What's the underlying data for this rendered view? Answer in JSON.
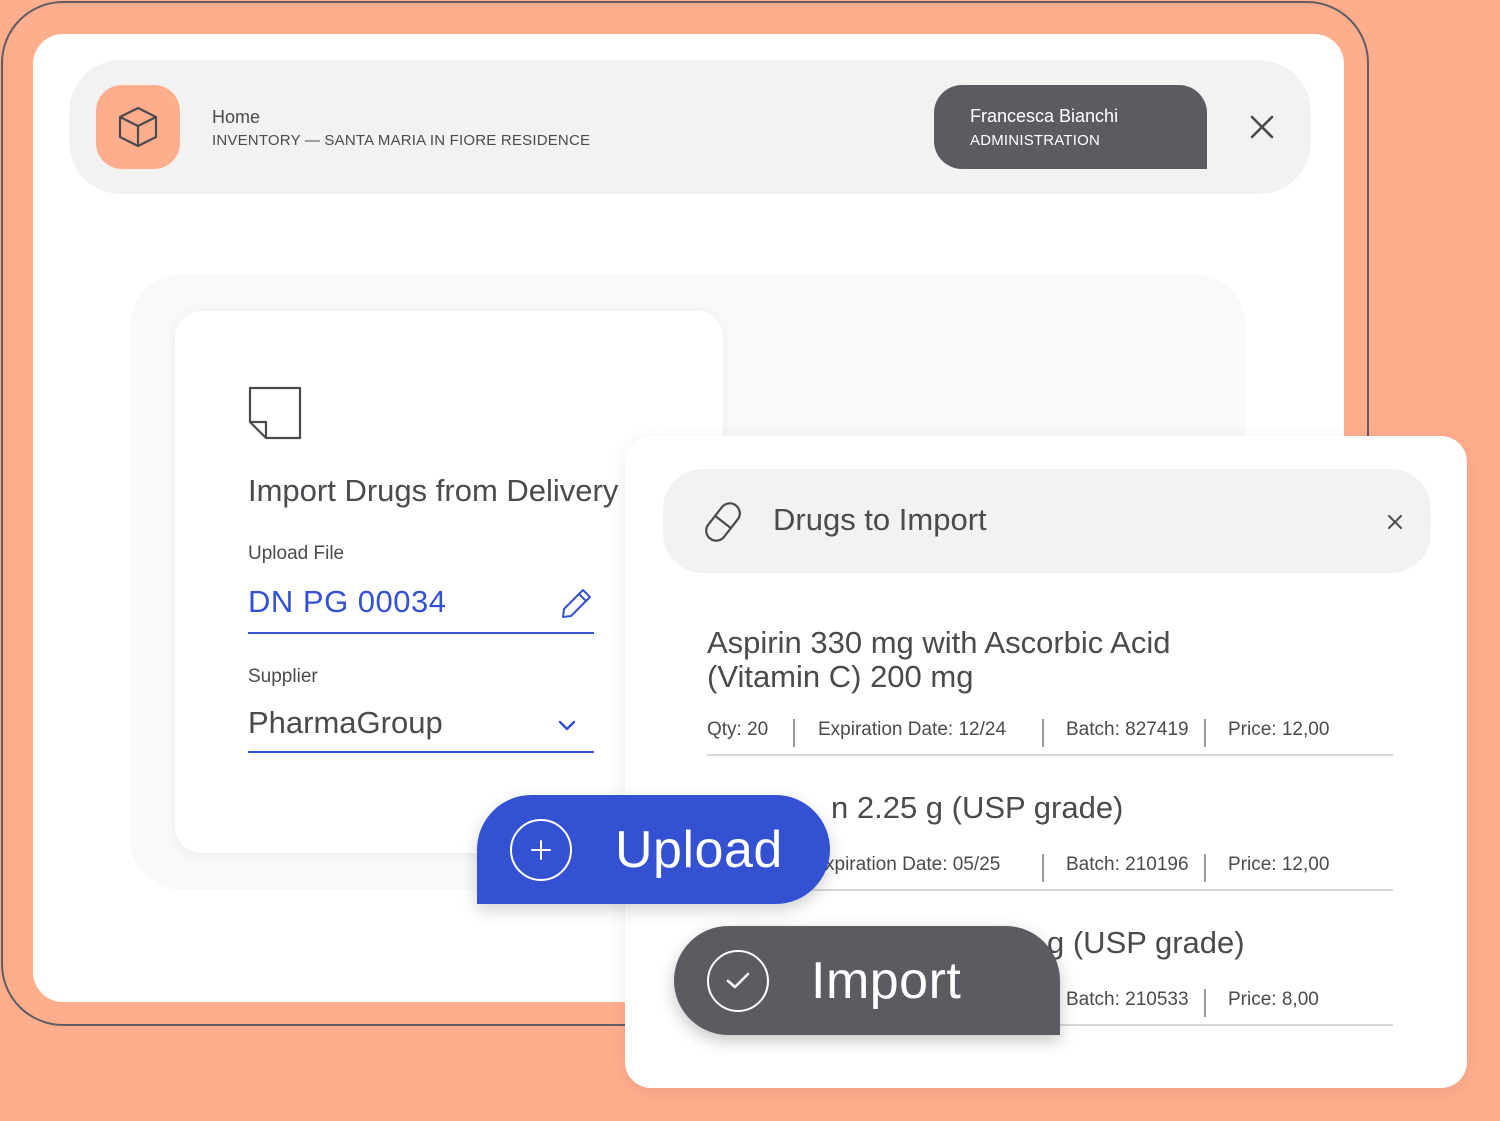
{
  "colors": {
    "background": "#FFAE8D",
    "accent_blue": "#3451d1",
    "dark_gray": "#5b5c62",
    "panel_gray": "#f1f2f1"
  },
  "header": {
    "app_icon": "cube-icon",
    "breadcrumb_home": "Home",
    "breadcrumb_path": "INVENTORY — SANTA MARIA IN FIORE RESIDENCE",
    "user_name": "Francesca Bianchi",
    "user_role": "ADMINISTRATION",
    "close_icon": "close-icon"
  },
  "import_form": {
    "icon": "document-icon",
    "title": "Import Drugs from Delivery",
    "upload_label": "Upload File",
    "upload_value": "DN PG 00034",
    "edit_icon": "pencil-icon",
    "supplier_label": "Supplier",
    "supplier_value": "PharmaGroup",
    "dropdown_icon": "chevron-down-icon"
  },
  "drugs_panel": {
    "icon": "pill-icon",
    "title": "Drugs to Import",
    "close_icon": "close-icon",
    "items": [
      {
        "name": "Aspirin 330 mg with Ascorbic Acid (Vitamin C) 200 mg",
        "qty": "Qty: 20",
        "expiration": "Expiration Date: 12/24",
        "batch": "Batch: 827419",
        "price": "Price: 12,00"
      },
      {
        "name": "n 2.25 g (USP grade)",
        "expiration": "xpiration Date: 05/25",
        "batch": "Batch: 210196",
        "price": "Price: 12,00"
      },
      {
        "name": "g (USP grade)",
        "batch": "Batch: 210533",
        "price": "Price: 8,00"
      }
    ]
  },
  "actions": {
    "upload_label": "Upload",
    "upload_icon": "plus-circle-icon",
    "import_label": "Import",
    "import_icon": "check-circle-icon"
  }
}
